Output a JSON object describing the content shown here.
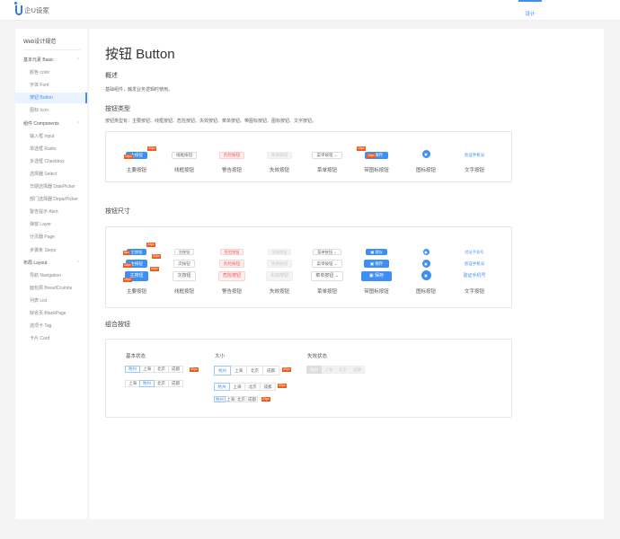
{
  "header": {
    "logo_text": "企U设家",
    "nav_tab": "设计"
  },
  "sidebar": {
    "title": "Web设计规范",
    "items": [
      {
        "label": "基本元素 Basic",
        "type": "group"
      },
      {
        "label": "颜色 color"
      },
      {
        "label": "字体 Font"
      },
      {
        "label": "按钮 Button",
        "active": true
      },
      {
        "label": "图标 Icon"
      },
      {
        "label": "组件 Components",
        "type": "group"
      },
      {
        "label": "输入框 Input"
      },
      {
        "label": "单选框 Radio"
      },
      {
        "label": "多选框 Checkbox"
      },
      {
        "label": "选择器 Select"
      },
      {
        "label": "日期选择器 DatePicker"
      },
      {
        "label": "部门选择器 DeparPicker"
      },
      {
        "label": "警告提示 Alert"
      },
      {
        "label": "弹窗 Layer"
      },
      {
        "label": "分页器 Page"
      },
      {
        "label": "步骤条 Steps"
      },
      {
        "label": "布局 Layout",
        "type": "group"
      },
      {
        "label": "导航 Navigation"
      },
      {
        "label": "面包屑 BreadCrumbs"
      },
      {
        "label": "列表 List"
      },
      {
        "label": "缺省页 BlankPage"
      },
      {
        "label": "选项卡 Tag"
      },
      {
        "label": "卡片 Card"
      }
    ]
  },
  "main": {
    "title": "按钮 Button",
    "overview_title": "概述",
    "overview_text": "基础组件，触发业务逻辑时使用。",
    "types_title": "按钮类型",
    "types_text": "按钮类型有：主要按钮、线框按钮、危险按钮、失效按钮、菜单按钮、带图标按钮、图标按钮、文字按钮。",
    "types": {
      "primary": "主按钮",
      "outline": "线框按钮",
      "danger": "危险按钮",
      "disabled": "失效按钮",
      "menu": "菜单按钮",
      "save": "保存",
      "text": "验证手机号",
      "tag_30": "30px",
      "tag_10": "10px",
      "captions": [
        "主要按钮",
        "线框按钮",
        "警告按钮",
        "失效按钮",
        "菜单按钮",
        "带图标按钮",
        "图标按钮",
        "文字按钮"
      ]
    },
    "sizes_title": "按钮尺寸",
    "sizes": {
      "primary": "主按钮",
      "secondary": "次按钮",
      "danger": "危险按钮",
      "disabled": "失效按钮",
      "menu": "菜单按钮",
      "save": "保存",
      "text": "验证手机号",
      "tags": [
        "24px",
        "32px",
        "40px",
        "8px",
        "16px",
        "16px"
      ],
      "captions": [
        "主要按钮",
        "线框按钮",
        "警告按钮",
        "失效按钮",
        "菜单按钮",
        "带图标按钮",
        "图标按钮",
        "文字按钮"
      ]
    },
    "group_title": "组合按钮",
    "group": {
      "basic_label": "基本状态",
      "size_label": "大小",
      "disabled_label": "失效状态",
      "cities": [
        "杭州",
        "上海",
        "北京",
        "成都"
      ],
      "cities_b": [
        "上海",
        "杭州",
        "北京",
        "成都"
      ],
      "tags": [
        "30px",
        "30px",
        "32px",
        "24px"
      ]
    }
  }
}
